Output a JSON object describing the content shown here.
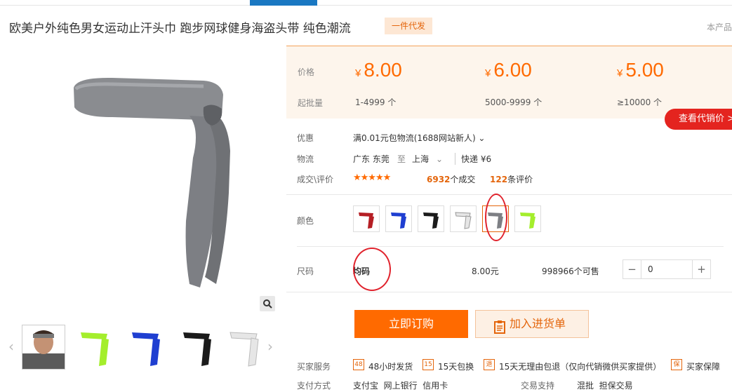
{
  "title": "欧美户外纯色男女运动止汗头巾 跑步网球健身海盗头带 纯色潮流",
  "badge": "一件代发",
  "cut_right_text": "本产品",
  "price_box": {
    "price_label": "价格",
    "moq_label": "起批量",
    "tiers": [
      {
        "currency": "¥",
        "price": "8.00",
        "range": "1-4999 个"
      },
      {
        "currency": "¥",
        "price": "6.00",
        "range": "5000-9999 个"
      },
      {
        "currency": "¥",
        "price": "5.00",
        "range": "≥10000 个"
      }
    ]
  },
  "agent_price_button": "查看代销价 >",
  "promo": {
    "label": "优惠",
    "value": "满0.01元包物流(1688网站新人) ⌄"
  },
  "logistics": {
    "label": "物流",
    "from": "广东 东莞",
    "to_word": "至",
    "to": "上海",
    "express": "快递 ¥6"
  },
  "deals": {
    "label": "成交\\评价",
    "stars": "★★★★★",
    "deal_count": "6932",
    "deal_suffix": "个成交",
    "review_count": "122",
    "review_suffix": "条评价"
  },
  "color": {
    "label": "颜色",
    "swatches": [
      "red",
      "blue",
      "black",
      "white",
      "gray",
      "lime"
    ],
    "swatch_colors": [
      "#b51e24",
      "#1f3fd1",
      "#1b1b1b",
      "#e6e6e6",
      "#7d7f84",
      "#a4ee2c"
    ]
  },
  "size": {
    "label": "尺码",
    "name": "均码",
    "price": "8.00元",
    "stock": "998966个可售",
    "qty": "0",
    "minus": "−",
    "plus": "+"
  },
  "buttons": {
    "buy": "立即订购",
    "cart": "加入进货单"
  },
  "services": {
    "label": "买家服务",
    "items": [
      {
        "icon": "48",
        "text": "48小时发货"
      },
      {
        "icon": "15",
        "text": "15天包换"
      },
      {
        "icon": "退",
        "text": "15天无理由包退（仅向代销微供买家提供）"
      },
      {
        "icon": "保",
        "text": "买家保障"
      }
    ]
  },
  "payment": {
    "label": "支付方式",
    "methods": "支付宝  网上银行  信用卡",
    "trade_label": "交易支持",
    "trade": "混批  担保交易"
  }
}
